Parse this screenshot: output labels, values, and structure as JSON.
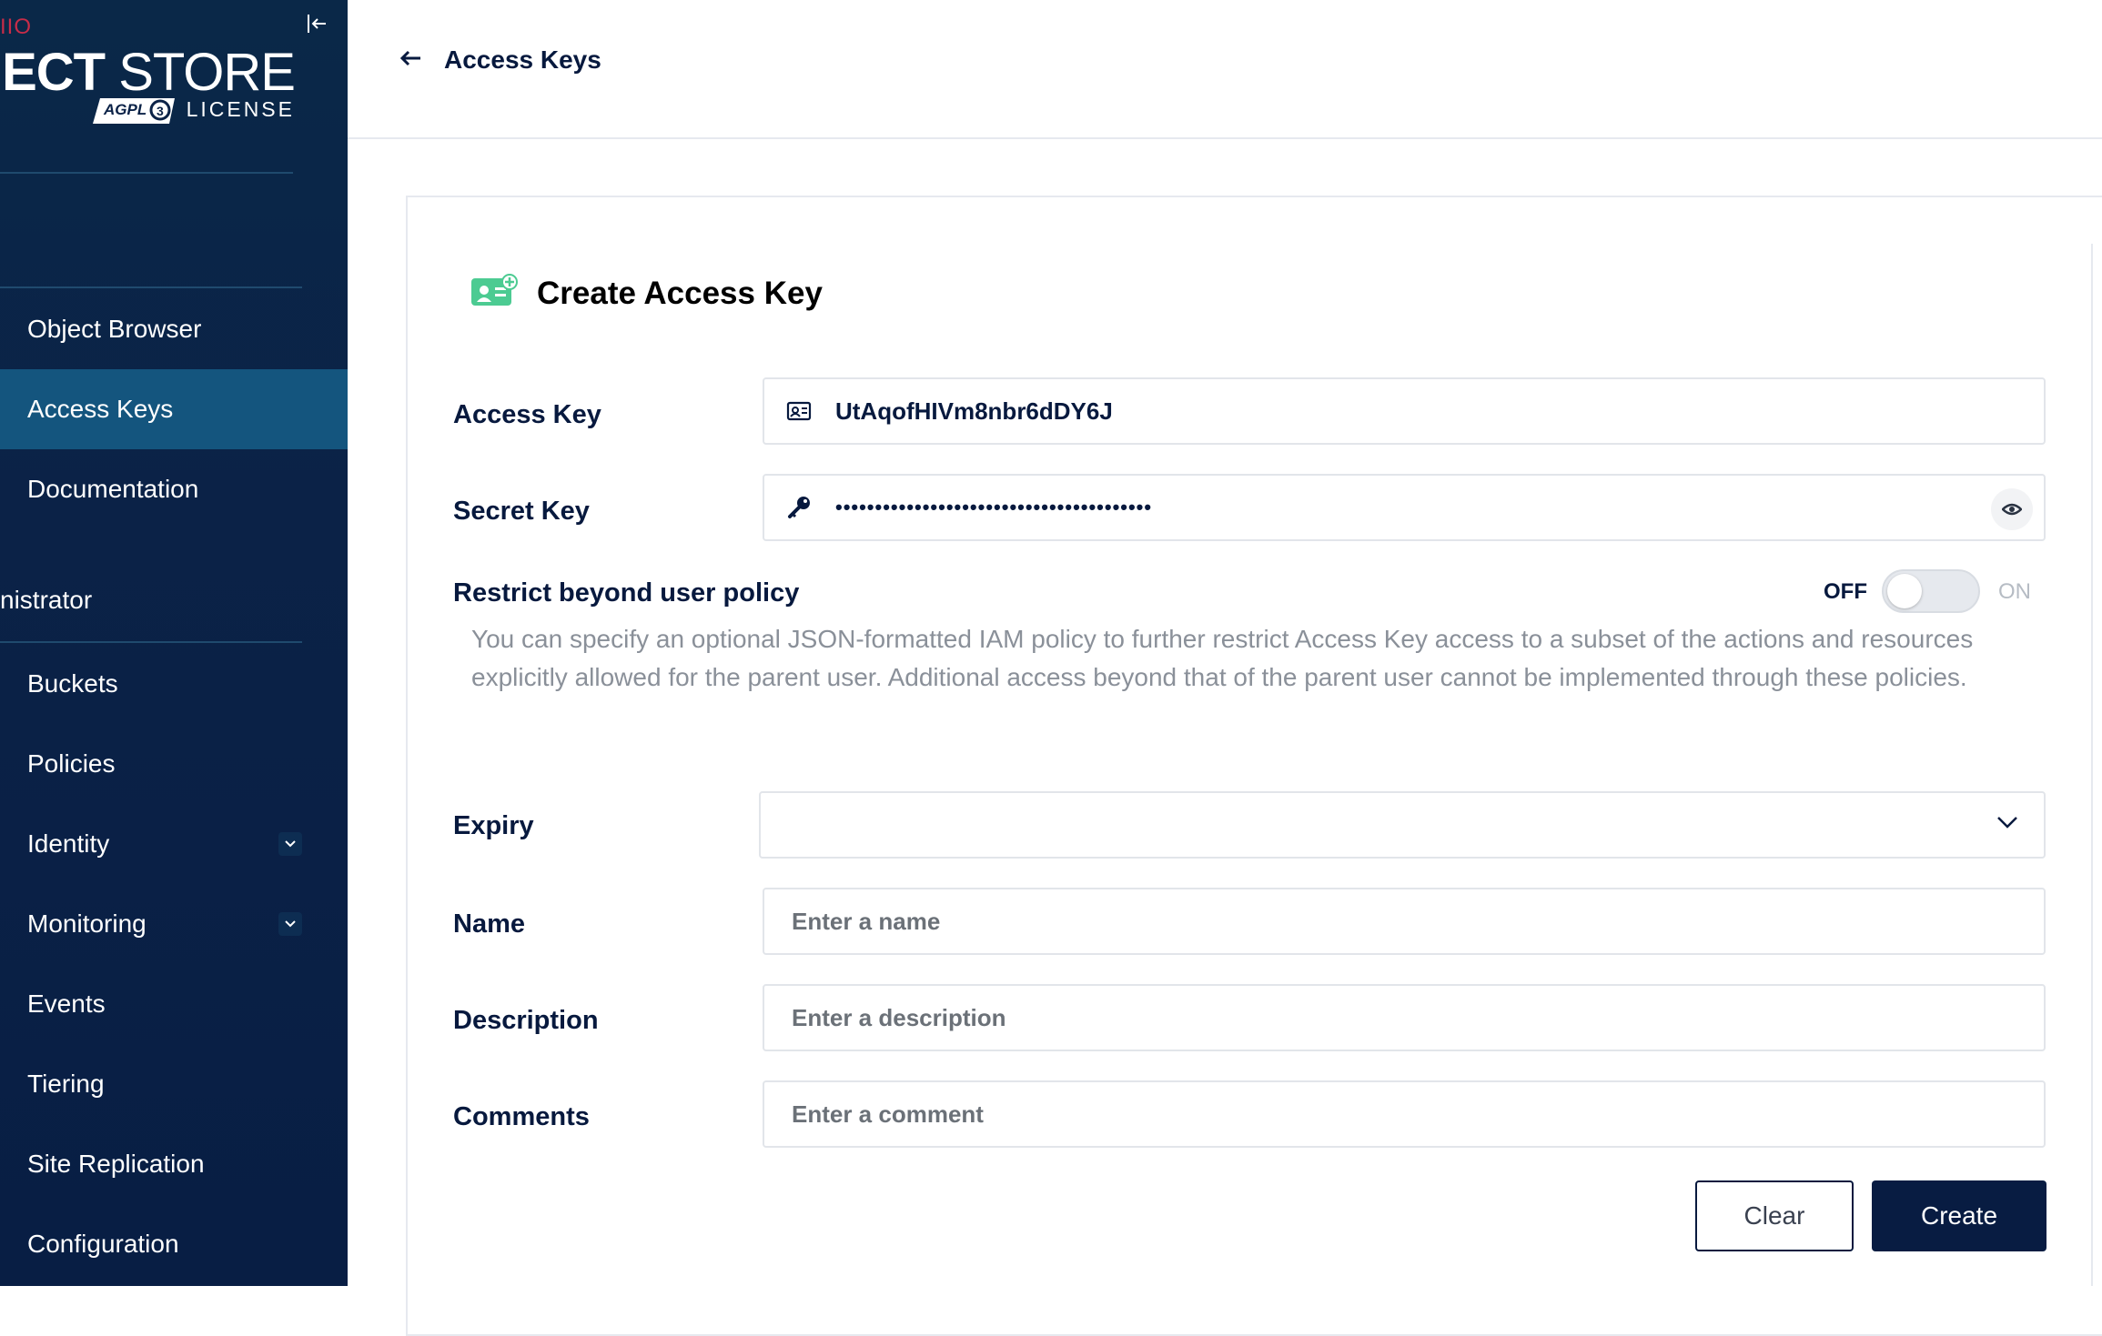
{
  "sidebar": {
    "brand_fragment": "IIO",
    "brand_bold": "BJECT",
    "brand_light": " STORE",
    "license_label": "LICENSE",
    "badge_text": "AGPL",
    "nav_top": [
      {
        "label": "Object Browser"
      },
      {
        "label": "Access Keys",
        "active": true
      },
      {
        "label": "Documentation"
      }
    ],
    "section_label": "nistrator",
    "nav_admin": [
      {
        "label": "Buckets"
      },
      {
        "label": "Policies"
      },
      {
        "label": "Identity",
        "expandable": true
      },
      {
        "label": "Monitoring",
        "expandable": true
      },
      {
        "label": "Events"
      },
      {
        "label": "Tiering"
      },
      {
        "label": "Site Replication"
      },
      {
        "label": "Configuration"
      }
    ]
  },
  "topbar": {
    "back_label": "Access Keys",
    "back_icon": "arrow-left-icon"
  },
  "form": {
    "title": "Create Access Key",
    "title_icon": "add-access-key-icon",
    "access_key": {
      "label": "Access Key",
      "value": "UtAqofHIVm8nbr6dDY6J",
      "icon": "id-card-icon"
    },
    "secret_key": {
      "label": "Secret Key",
      "value": "••••••••••••••••••••••••••••••••••••••••",
      "icon": "key-icon",
      "reveal_icon": "eye-icon"
    },
    "restrict": {
      "label": "Restrict beyond user policy",
      "off_label": "OFF",
      "on_label": "ON",
      "enabled": false,
      "help": "You can specify an optional JSON-formatted IAM policy to further restrict Access Key access to a subset of the actions and resources explicitly allowed for the parent user. Additional access beyond that of the parent user cannot be implemented through these policies."
    },
    "expiry": {
      "label": "Expiry",
      "value": ""
    },
    "name": {
      "label": "Name",
      "placeholder": "Enter a name"
    },
    "description": {
      "label": "Description",
      "placeholder": "Enter a description"
    },
    "comments": {
      "label": "Comments",
      "placeholder": "Enter a comment"
    },
    "clear_label": "Clear",
    "create_label": "Create"
  },
  "colors": {
    "sidebar_bg": "#0b2247",
    "sidebar_active": "#14557e",
    "brand_red": "#c72c48",
    "primary_button": "#081c42",
    "title_icon_green": "#4ccb92"
  }
}
